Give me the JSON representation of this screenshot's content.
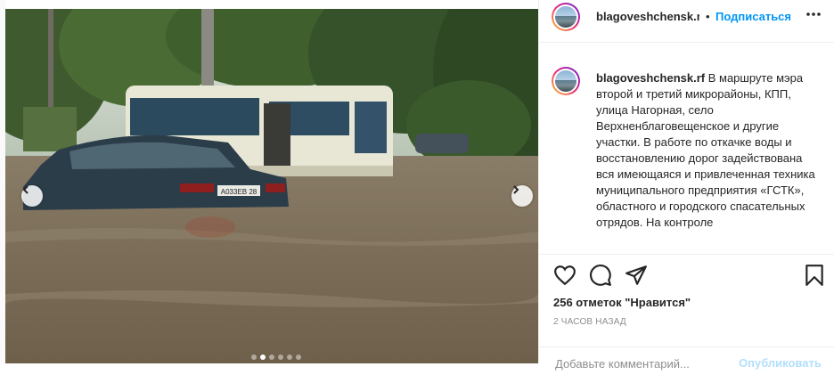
{
  "account": {
    "username": "blagoveshchensk.rf",
    "username_header": "blagoveshchensk.r",
    "separator": "•",
    "follow_label": "Подписаться",
    "more_icon": "more-horizontal-icon"
  },
  "post": {
    "caption_user": "blagoveshchensk.rf",
    "caption_text": " В маршруте мэра второй и третий микрорайоны, КПП, улица Нагорная, село Верхненблаговещенское и другие участки. В работе по откачке воды и восстановлению дорог задействована вся имеющаяся и привлеченная техника муниципального предприятия «ГСТК», областного и городского спасательных отрядов. На контроле",
    "likes": "256 отметок \"Нравится\"",
    "timestamp": "2 ЧАСОВ НАЗАД",
    "car_plate": "А033ЕВ 28",
    "carousel": {
      "total_slides": 6,
      "active_slide": 2
    }
  },
  "actions": {
    "like_icon": "heart-icon",
    "comment_icon": "comment-icon",
    "share_icon": "share-icon",
    "save_icon": "bookmark-icon"
  },
  "comment": {
    "placeholder": "Добавьте комментарий...",
    "post_label": "Опубликовать"
  },
  "colors": {
    "accent": "#0095f6",
    "text": "#262626",
    "muted": "#8e8e8e",
    "border": "#efefef"
  }
}
